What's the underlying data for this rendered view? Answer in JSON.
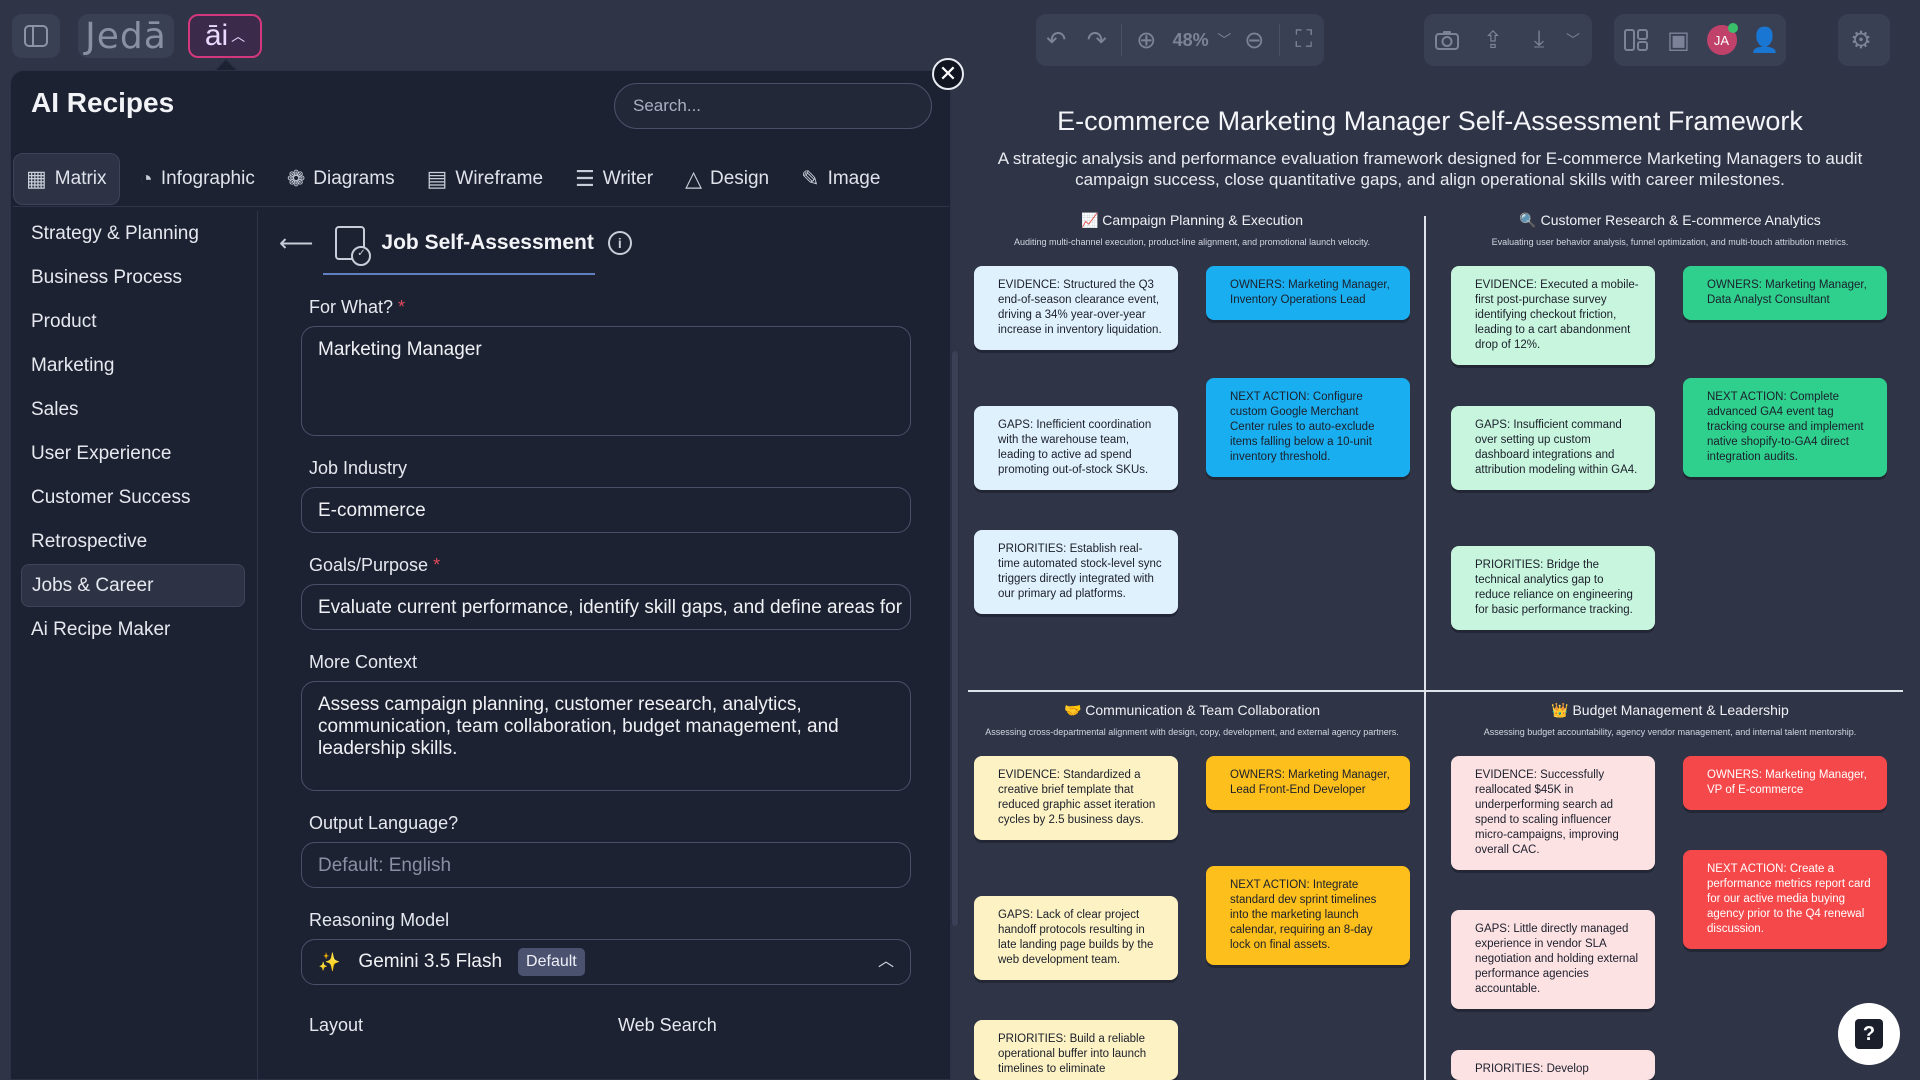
{
  "toolbar": {
    "logo": "Jedā",
    "ai_label": "āi",
    "zoom": "48%",
    "avatar_initials": "JA"
  },
  "panel": {
    "title": "AI Recipes",
    "search_placeholder": "Search...",
    "tabs": [
      {
        "icon": "matrix-icon",
        "label": "Matrix"
      },
      {
        "icon": "infographic-icon",
        "label": "Infographic"
      },
      {
        "icon": "diagrams-icon",
        "label": "Diagrams"
      },
      {
        "icon": "wireframe-icon",
        "label": "Wireframe"
      },
      {
        "icon": "writer-icon",
        "label": "Writer"
      },
      {
        "icon": "design-icon",
        "label": "Design"
      },
      {
        "icon": "image-icon",
        "label": "Image"
      }
    ],
    "categories": [
      "Strategy & Planning",
      "Business Process",
      "Product",
      "Marketing",
      "Sales",
      "User Experience",
      "Customer Success",
      "Retrospective",
      "Jobs & Career",
      "Ai Recipe Maker"
    ],
    "active_category": "Jobs & Career"
  },
  "form": {
    "title": "Job Self-Assessment",
    "for_what_label": "For What?",
    "for_what_value": "Marketing Manager",
    "industry_label": "Job Industry",
    "industry_value": "E-commerce",
    "goals_label": "Goals/Purpose",
    "goals_value": "Evaluate current performance, identify skill gaps, and define areas for",
    "context_label": "More Context",
    "context_value": "Assess campaign planning, customer research, analytics, communication, team collaboration, budget management, and leadership skills.",
    "language_label": "Output Language?",
    "language_placeholder": "Default: English",
    "model_label": "Reasoning Model",
    "model_value": "Gemini 3.5 Flash",
    "model_badge": "Default",
    "layout_label": "Layout",
    "websearch_label": "Web Search"
  },
  "framework": {
    "title": "E-commerce Marketing Manager Self-Assessment Framework",
    "subtitle": "A strategic analysis and performance evaluation framework designed for E-commerce Marketing Managers to audit campaign success, close quantitative gaps, and align operational skills with career milestones.",
    "quadrants": [
      {
        "title": "📈 Campaign Planning & Execution",
        "desc": "Auditing multi-channel execution, product-line alignment, and promotional launch velocity.",
        "evidence": "EVIDENCE: Structured the Q3 end-of-season clearance event, driving a 34% year-over-year increase in inventory liquidation.",
        "owners": "OWNERS: Marketing Manager, Inventory Operations Lead",
        "gaps": "GAPS: Inefficient coordination with the warehouse team, leading to active ad spend promoting out-of-stock SKUs.",
        "next": "NEXT ACTION: Configure custom Google Merchant Center rules to auto-exclude items falling below a 10-unit inventory threshold.",
        "priorities": "PRIORITIES: Establish real-time automated stock-level sync triggers directly integrated with our primary ad platforms."
      },
      {
        "title": "🔍 Customer Research & E-commerce Analytics",
        "desc": "Evaluating user behavior analysis, funnel optimization, and multi-touch attribution metrics.",
        "evidence": "EVIDENCE: Executed a mobile-first post-purchase survey identifying checkout friction, leading to a cart abandonment drop of 12%.",
        "owners": "OWNERS: Marketing Manager, Data Analyst Consultant",
        "gaps": "GAPS: Insufficient command over setting up custom dashboard integrations and attribution modeling within GA4.",
        "next": "NEXT ACTION: Complete advanced GA4 event tag tracking course and implement native shopify-to-GA4 direct integration audits.",
        "priorities": "PRIORITIES: Bridge the technical analytics gap to reduce reliance on engineering for basic performance tracking."
      },
      {
        "title": "🤝 Communication & Team Collaboration",
        "desc": "Assessing cross-departmental alignment with design, copy, development, and external agency partners.",
        "evidence": "EVIDENCE: Standardized a creative brief template that reduced graphic asset iteration cycles by 2.5 business days.",
        "owners": "OWNERS: Marketing Manager, Lead Front-End Developer",
        "gaps": "GAPS: Lack of clear project handoff protocols resulting in late landing page builds by the web development team.",
        "next": "NEXT ACTION: Integrate standard dev sprint timelines into the marketing launch calendar, requiring an 8-day lock on final assets.",
        "priorities": "PRIORITIES: Build a reliable operational buffer into launch timelines to eliminate"
      },
      {
        "title": "👑 Budget Management & Leadership",
        "desc": "Assessing budget accountability, agency vendor management, and internal talent mentorship.",
        "evidence": "EVIDENCE: Successfully reallocated $45K in underperforming search ad spend to scaling influencer micro-campaigns, improving overall CAC.",
        "owners": "OWNERS: Marketing Manager, VP of E-commerce",
        "gaps": "GAPS: Little directly managed experience in vendor SLA negotiation and holding external performance agencies accountable.",
        "next": "NEXT ACTION: Create a performance metrics report card for our active media buying agency prior to the Q4 renewal discussion.",
        "priorities": "PRIORITIES: Develop"
      }
    ]
  },
  "colors": {
    "background": "#2f3447",
    "panel": "#1d2232",
    "accent_pink": "#d3387d",
    "blue_light": "#dff1fd",
    "blue_dark": "#19aef0",
    "green_light": "#c8f5dd",
    "green_dark": "#2fd08e",
    "yellow_light": "#fdf2c3",
    "yellow_dark": "#fdbf1c",
    "red_light": "#fde2e4",
    "red_dark": "#f5484a"
  }
}
